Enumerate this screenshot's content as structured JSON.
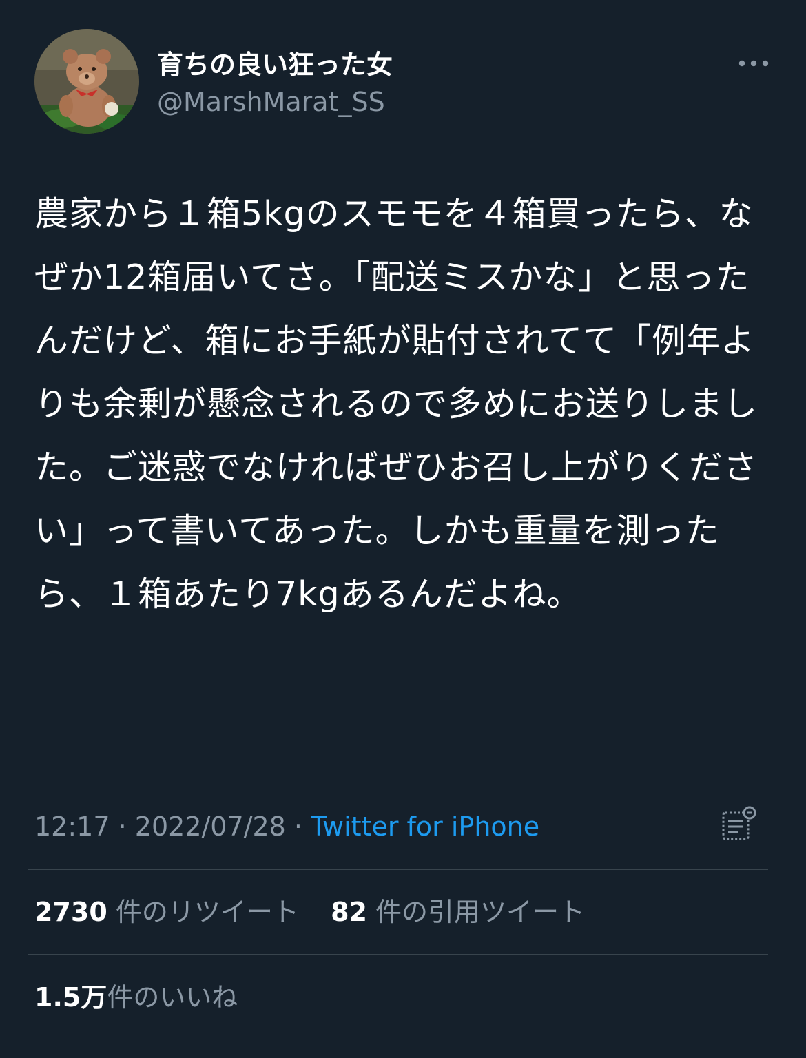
{
  "author": {
    "display_name": "育ちの良い狂った女",
    "handle": "@MarshMarat_SS"
  },
  "tweet": {
    "text": "農家から１箱5kgのスモモを４箱買ったら、なぜか12箱届いてさ。「配送ミスかな」と思ったんだけど、箱にお手紙が貼付されてて「例年よりも余剰が懸念されるので多めにお送りしました。ご迷惑でなければぜひお召し上がりください」って書いてあった。しかも重量を測ったら、１箱あたり7kgあるんだよね。",
    "time": "12:17",
    "separator": "·",
    "date": "2022/07/28",
    "source": "Twitter for iPhone"
  },
  "stats": {
    "retweets_count": "2730",
    "retweets_label": "件のリツイート",
    "quotes_count": "82",
    "quotes_label": "件の引用ツイート",
    "likes_count": "1.5万",
    "likes_label": "件のいいね"
  },
  "icons": {
    "more": "more-horizontal-icon",
    "analytics": "tweet-analytics-icon"
  },
  "colors": {
    "background": "#15202b",
    "text": "#ffffff",
    "secondary": "#8b98a5",
    "accent": "#1d9bf0",
    "divider": "#38444d"
  }
}
